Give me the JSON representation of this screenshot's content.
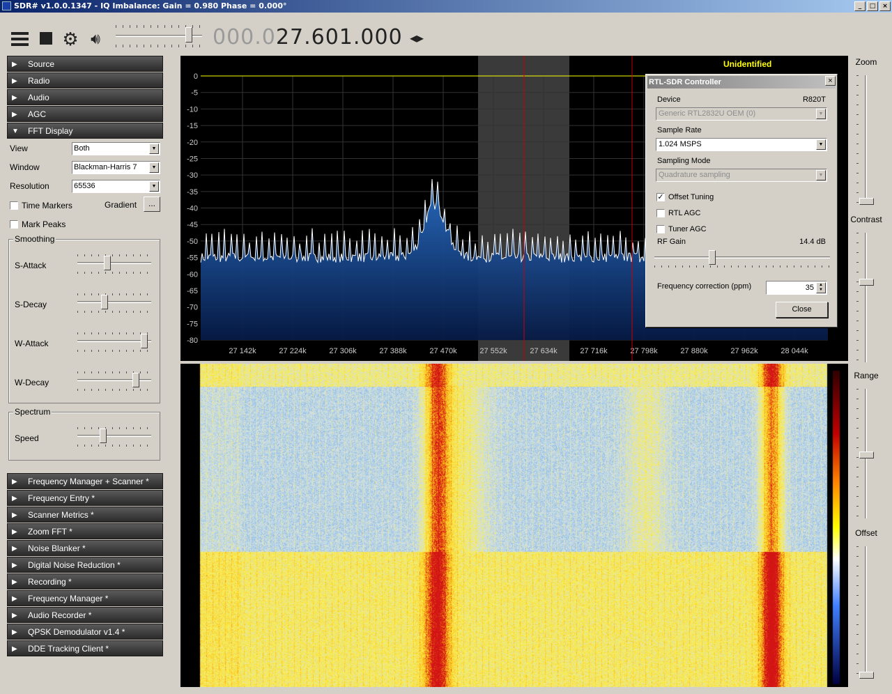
{
  "window": {
    "title": "SDR# v1.0.0.1347 - IQ Imbalance: Gain = 0.980 Phase = 0.000°"
  },
  "toolbar": {
    "freq_dim": "000.0",
    "freq_bright": "27.601.000",
    "arrows": "◂▸"
  },
  "sections_top": [
    "Source",
    "Radio",
    "Audio",
    "AGC",
    "FFT Display"
  ],
  "fft": {
    "view_label": "View",
    "view_value": "Both",
    "window_label": "Window",
    "window_value": "Blackman-Harris 7",
    "resolution_label": "Resolution",
    "resolution_value": "65536",
    "time_markers": "Time Markers",
    "gradient": "Gradient",
    "gradient_btn": "...",
    "mark_peaks": "Mark Peaks",
    "smoothing": "Smoothing",
    "s_attack": "S-Attack",
    "s_decay": "S-Decay",
    "w_attack": "W-Attack",
    "w_decay": "W-Decay",
    "spectrum": "Spectrum",
    "speed": "Speed",
    "slider_levels": {
      "s_attack": 0.4,
      "s_decay": 0.35,
      "w_attack": 0.95,
      "w_decay": 0.82,
      "speed": 0.33
    }
  },
  "sections_bottom": [
    "Frequency Manager + Scanner *",
    "Frequency Entry *",
    "Scanner Metrics *",
    "Zoom FFT *",
    "Noise Blanker *",
    "Digital Noise Reduction *",
    "Recording *",
    "Frequency Manager *",
    "Audio Recorder *",
    "QPSK Demodulator v1.4 *",
    "DDE Tracking Client *"
  ],
  "right": {
    "zoom": "Zoom",
    "contrast": "Contrast",
    "range": "Range",
    "offset": "Offset"
  },
  "spectrum_axes": {
    "ylabels": [
      "0",
      "-5",
      "-10",
      "-15",
      "-20",
      "-25",
      "-30",
      "-35",
      "-40",
      "-45",
      "-50",
      "-55",
      "-60",
      "-65",
      "-70",
      "-75",
      "-80"
    ],
    "xlabels": [
      "27 142k",
      "27 224k",
      "27 306k",
      "27 388k",
      "27 470k",
      "27 552k",
      "27 634k",
      "27 716k",
      "27 798k",
      "27 880k",
      "27 962k",
      "28 044k"
    ],
    "station": "Unidentified"
  },
  "dialog": {
    "title": "RTL-SDR Controller",
    "device_label": "Device",
    "device_model": "R820T",
    "device_value": "Generic RTL2832U OEM (0)",
    "sample_rate_label": "Sample Rate",
    "sample_rate_value": "1.024 MSPS",
    "sampling_mode_label": "Sampling Mode",
    "sampling_mode_value": "Quadrature sampling",
    "offset_tuning": "Offset Tuning",
    "offset_tuning_checked": true,
    "rtl_agc": "RTL AGC",
    "tuner_agc": "Tuner AGC",
    "rf_gain_label": "RF Gain",
    "rf_gain_value": "14.4 dB",
    "freq_corr_label": "Frequency correction (ppm)",
    "freq_corr_value": "35",
    "close_btn": "Close"
  },
  "colors": {
    "spectrum_fill": "#1a5aa8",
    "trace": "#ffffff",
    "marker": "#cc0000",
    "station": "#ffff00"
  }
}
